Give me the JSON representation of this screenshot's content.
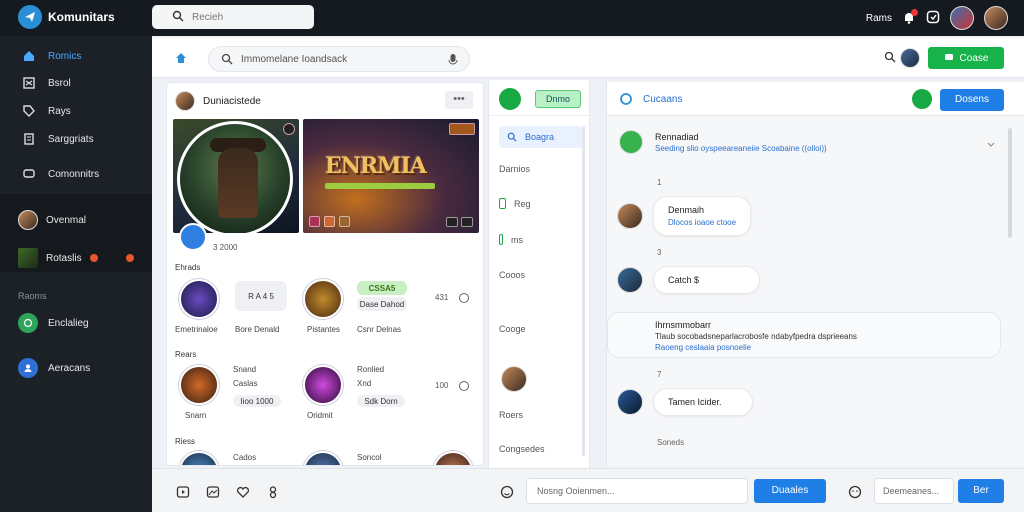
{
  "app": {
    "title": "Komunitars",
    "search_placeholder": "Recieh"
  },
  "topbar": {
    "label": "Rams"
  },
  "colors": {
    "accent": "#1f7fe6",
    "green": "#17b24a",
    "sidebar": "#1c2128",
    "topbar": "#151a20"
  },
  "sidebar": {
    "items": [
      {
        "label": "Romics",
        "icon": "home-icon",
        "active": true
      },
      {
        "label": "Bsrol",
        "icon": "grid-icon"
      },
      {
        "label": "Rays",
        "icon": "tag-icon"
      },
      {
        "label": "Sarggriats",
        "icon": "document-icon"
      },
      {
        "label": "Comonnitrs",
        "icon": "chat-icon"
      }
    ],
    "people": [
      {
        "label": "Ovenmal"
      },
      {
        "label": "Rotaslis"
      }
    ],
    "section_heading": "Raoms",
    "channels": [
      {
        "label": "Enclalieg",
        "icon": "globe-icon"
      },
      {
        "label": "Aeracans",
        "icon": "person-icon"
      }
    ]
  },
  "mainbar": {
    "search_text": "Immomelane Ioandsack",
    "primary_button": "Coase"
  },
  "feed": {
    "header_name": "Duniacistede",
    "banner_title": "ENRMIA",
    "meta": "3 2000",
    "section1": "Ehrads",
    "row1": [
      {
        "caption": "Emetrinaloe"
      },
      {
        "pill": "R A 4 5",
        "caption": "Bore Denald"
      },
      {
        "caption": "Pistantes"
      },
      {
        "pill": "Dase Dahod",
        "caption": "Csnr Delnas",
        "badge": "CSSA5"
      },
      {
        "num": "431"
      }
    ],
    "section2": "Rears",
    "row2": [
      {
        "title": "Snand",
        "sub": "Caslas",
        "pill": "Iioo 1000",
        "caption": "Snarn"
      },
      {
        "title": "Ronlied",
        "sub": "Xnd",
        "pill": "Sdk Dorn",
        "caption": "Oridmit"
      },
      {
        "num": "100"
      }
    ],
    "section3": "Riess",
    "row3": [
      {
        "caption": "Cados"
      },
      {
        "caption": "Soncol"
      }
    ]
  },
  "midnav": {
    "chip": "Dnmo",
    "items": [
      {
        "label": "Boagra",
        "active": true
      },
      {
        "label": "Darnios"
      },
      {
        "label": "Reg"
      },
      {
        "label": "ms"
      },
      {
        "label": "Cooos"
      },
      {
        "label": "Cooge"
      },
      {
        "label": "Roers"
      },
      {
        "label": "Congsedes"
      }
    ]
  },
  "chat": {
    "title": "Cucaans",
    "button": "Dosens",
    "system1": {
      "title": "Rennadiad",
      "text": "Seeding slio oyspeeareaneiie Scoabaine ((olloi))"
    },
    "nums": [
      "1",
      "3",
      "7"
    ],
    "msg1": {
      "name": "Denmaih",
      "sub": "Dlocos ioaoe ctooe"
    },
    "msg2": {
      "name": "Catch $"
    },
    "system2": {
      "title": "Ihrnsmmobarr",
      "text": "Tlaub socobadsneparlacrobosfe ndabyfpedra dsprieeans",
      "text2": "Raoeng ceslaaia posnoelie"
    },
    "msg3": {
      "name": "Tamen Icider."
    },
    "footer": "Soneds"
  },
  "composer": {
    "placeholder": "Nosng Ooienmen...",
    "send": "Duaales",
    "second_placeholder": "Deemeanes...",
    "send2": "Ber"
  }
}
